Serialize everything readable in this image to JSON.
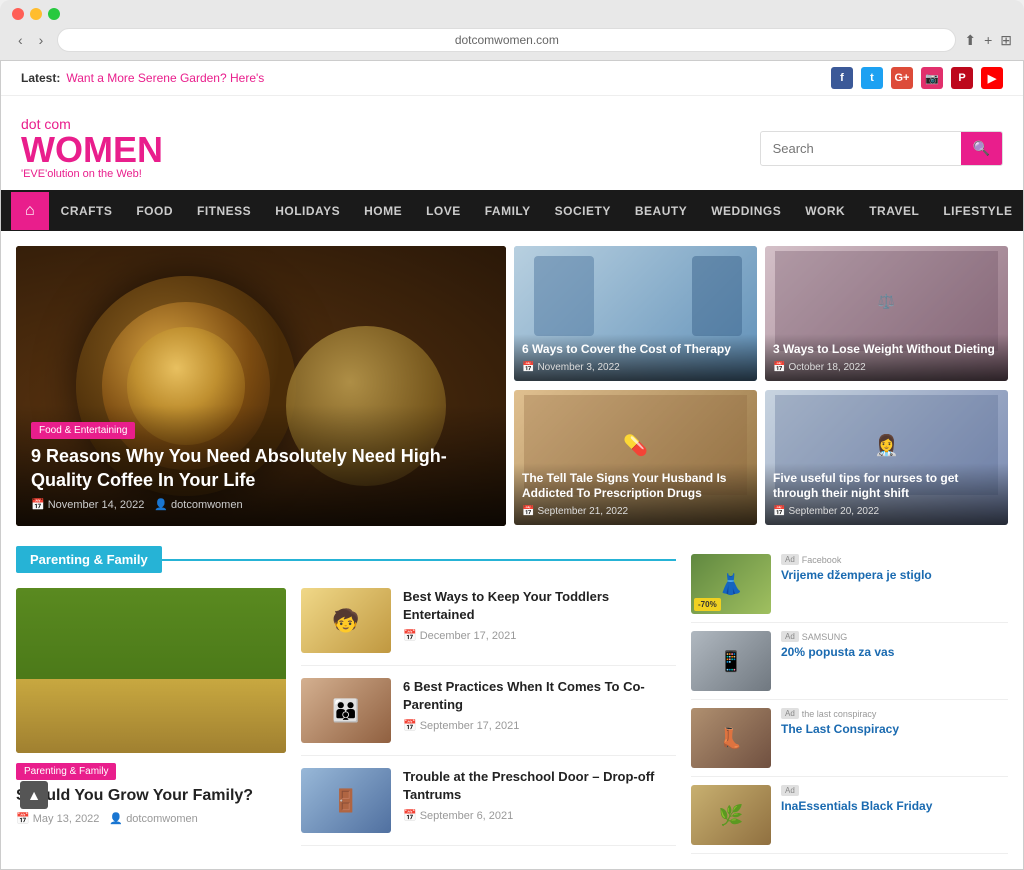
{
  "browser": {
    "url": "dotcomwomen.com",
    "back_btn": "‹",
    "forward_btn": "›"
  },
  "topbar": {
    "latest_label": "Latest:",
    "latest_article": "Want a More Serene Garden? Here's",
    "social": [
      {
        "name": "Facebook",
        "abbr": "f",
        "class": "si-fb"
      },
      {
        "name": "Twitter",
        "abbr": "t",
        "class": "si-tw"
      },
      {
        "name": "Google+",
        "abbr": "G+",
        "class": "si-gp"
      },
      {
        "name": "Instagram",
        "abbr": "in",
        "class": "si-ig"
      },
      {
        "name": "Pinterest",
        "abbr": "p",
        "class": "si-pi"
      },
      {
        "name": "YouTube",
        "abbr": "▶",
        "class": "si-yt"
      }
    ]
  },
  "header": {
    "logo_dotcom": "dot com",
    "logo_women": "WOMEN",
    "logo_tagline": "'EVE'olution on the Web!",
    "search_placeholder": "Search"
  },
  "nav": {
    "home_icon": "⌂",
    "items": [
      "CRAFTS",
      "FOOD",
      "FITNESS",
      "HOLIDAYS",
      "HOME",
      "LOVE",
      "FAMILY",
      "SOCIETY",
      "BEAUTY",
      "WEDDINGS",
      "WORK",
      "TRAVEL",
      "LIFESTYLE"
    ]
  },
  "hero": {
    "category": "Food & Entertaining",
    "title": "9 Reasons Why You Need Absolutely Need High-Quality Coffee In Your Life",
    "date": "November 14, 2022",
    "author": "dotcomwomen"
  },
  "side_articles": [
    {
      "title": "6 Ways to Cover the Cost of Therapy",
      "date": "November 3, 2022",
      "color_class": "sc1"
    },
    {
      "title": "3 Ways to Lose Weight Without Dieting",
      "date": "October 18, 2022",
      "color_class": "sc2"
    },
    {
      "title": "The Tell Tale Signs Your Husband Is Addicted To Prescription Drugs",
      "date": "September 21, 2022",
      "color_class": "sc3"
    },
    {
      "title": "Five useful tips for nurses to get through their night shift",
      "date": "September 20, 2022",
      "color_class": "sc4"
    }
  ],
  "parenting_section": {
    "label": "Parenting & Family",
    "featured": {
      "category": "Parenting & Family",
      "title": "Should You Grow Your Family?",
      "date": "May 13, 2022",
      "author": "dotcomwomen"
    },
    "articles": [
      {
        "title": "Best Ways to Keep Your Toddlers Entertained",
        "date": "December 17, 2021",
        "color_class": "at1"
      },
      {
        "title": "6 Best Practices When It Comes To Co-Parenting",
        "date": "September 17, 2021",
        "color_class": "at2"
      },
      {
        "title": "Trouble at the Preschool Door – Drop-off Tantrums",
        "date": "September 6, 2021",
        "color_class": "at3"
      }
    ]
  },
  "ads": [
    {
      "title": "Vrijeme džempera je stiglo",
      "sponsor": "Facebook",
      "ad_label": "Ad",
      "color_class": "ad1-bg",
      "sale_badge": "-70%"
    },
    {
      "title": "20% popusta za vas",
      "sponsor": "SAMSUNG",
      "ad_label": "Ad",
      "color_class": "ad2-bg",
      "sale_badge": ""
    },
    {
      "title": "The Last Conspiracy",
      "sponsor": "the last conspiracy",
      "ad_label": "Ad",
      "color_class": "ad3-bg",
      "sale_badge": ""
    },
    {
      "title": "InaEssentials Black Friday",
      "sponsor": "",
      "ad_label": "Ad",
      "color_class": "ad4-bg",
      "sale_badge": ""
    }
  ],
  "icons": {
    "calendar": "📅",
    "user": "👤",
    "search": "🔍",
    "home": "⌂",
    "chevron_up": "▲"
  }
}
